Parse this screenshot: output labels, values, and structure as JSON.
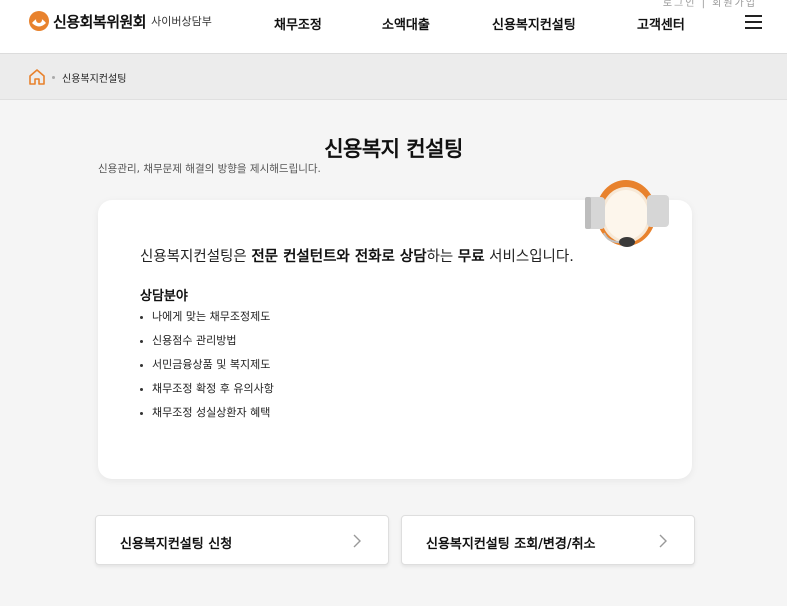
{
  "header": {
    "logo_name": "신용회복위원회",
    "logo_sub": "사이버상담부",
    "top_util": "로그인 | 회원가입",
    "nav": [
      "채무조정",
      "소액대출",
      "신용복지컨설팅",
      "고객센터"
    ]
  },
  "breadcrumb": {
    "current": "신용복지컨설팅"
  },
  "page": {
    "title": "신용복지 컨설팅",
    "description": "신용관리, 채무문제 해결의 방향을 제시해드립니다."
  },
  "card": {
    "intro_prefix": "신용복지컨설팅은 ",
    "intro_bold1": "전문 컨설턴트와 전화로 상담",
    "intro_mid": "하는 ",
    "intro_bold2": "무료",
    "intro_suffix": " 서비스입니다.",
    "section_title": "상담분야",
    "fields": [
      "나에게 맞는 채무조정제도",
      "신용점수 관리방법",
      "서민금융상품 및 복지제도",
      "채무조정 확정 후 유의사항",
      "채무조정 성실상환자 혜택"
    ]
  },
  "actions": [
    {
      "label": "신용복지컨설팅 신청"
    },
    {
      "label": "신용복지컨설팅 조회/변경/취소"
    }
  ],
  "colors": {
    "accent": "#e8822d",
    "page_bg": "#f5f5f5",
    "breadcrumb_bg": "#ececec"
  }
}
